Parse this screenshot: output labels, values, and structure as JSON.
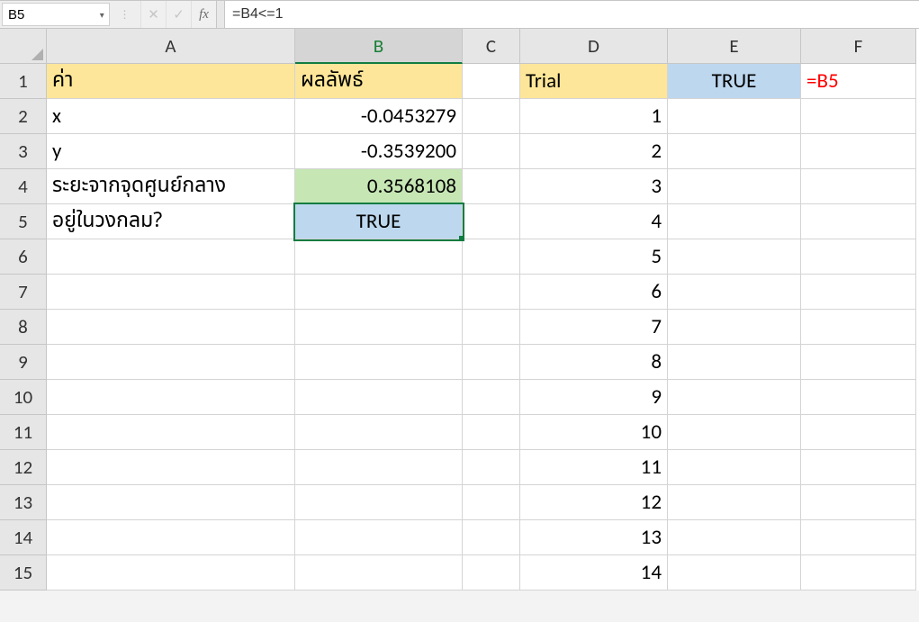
{
  "formula_bar": {
    "name_box_value": "B5",
    "fx_label": "fx",
    "formula_value": "=B4<=1"
  },
  "columns": [
    "A",
    "B",
    "C",
    "D",
    "E",
    "F"
  ],
  "row_count": 15,
  "active_cell": "B5",
  "cells": {
    "A1": {
      "v": "ค่า",
      "cls": "fill-yellow thai"
    },
    "B1": {
      "v": "ผลลัพธ์",
      "cls": "fill-yellow thai"
    },
    "D1": {
      "v": "Trial",
      "cls": "fill-yellow"
    },
    "E1": {
      "v": "TRUE",
      "cls": "fill-blue c"
    },
    "F1": {
      "v": "=B5",
      "cls": "red-text"
    },
    "A2": {
      "v": "x"
    },
    "B2": {
      "v": "-0.0453279",
      "cls": "r"
    },
    "D2": {
      "v": "1",
      "cls": "r"
    },
    "A3": {
      "v": "y"
    },
    "B3": {
      "v": "-0.3539200",
      "cls": "r"
    },
    "D3": {
      "v": "2",
      "cls": "r"
    },
    "A4": {
      "v": "ระยะจากจุดศูนย์กลาง",
      "cls": "thai"
    },
    "B4": {
      "v": "0.3568108",
      "cls": "r fill-green"
    },
    "D4": {
      "v": "3",
      "cls": "r"
    },
    "A5": {
      "v": "อยู่ในวงกลม?",
      "cls": "thai"
    },
    "B5": {
      "v": "TRUE",
      "cls": "c fill-blue active-cell"
    },
    "D5": {
      "v": "4",
      "cls": "r"
    },
    "D6": {
      "v": "5",
      "cls": "r"
    },
    "D7": {
      "v": "6",
      "cls": "r"
    },
    "D8": {
      "v": "7",
      "cls": "r"
    },
    "D9": {
      "v": "8",
      "cls": "r"
    },
    "D10": {
      "v": "9",
      "cls": "r"
    },
    "D11": {
      "v": "10",
      "cls": "r"
    },
    "D12": {
      "v": "11",
      "cls": "r"
    },
    "D13": {
      "v": "12",
      "cls": "r"
    },
    "D14": {
      "v": "13",
      "cls": "r"
    },
    "D15": {
      "v": "14",
      "cls": "r"
    }
  }
}
